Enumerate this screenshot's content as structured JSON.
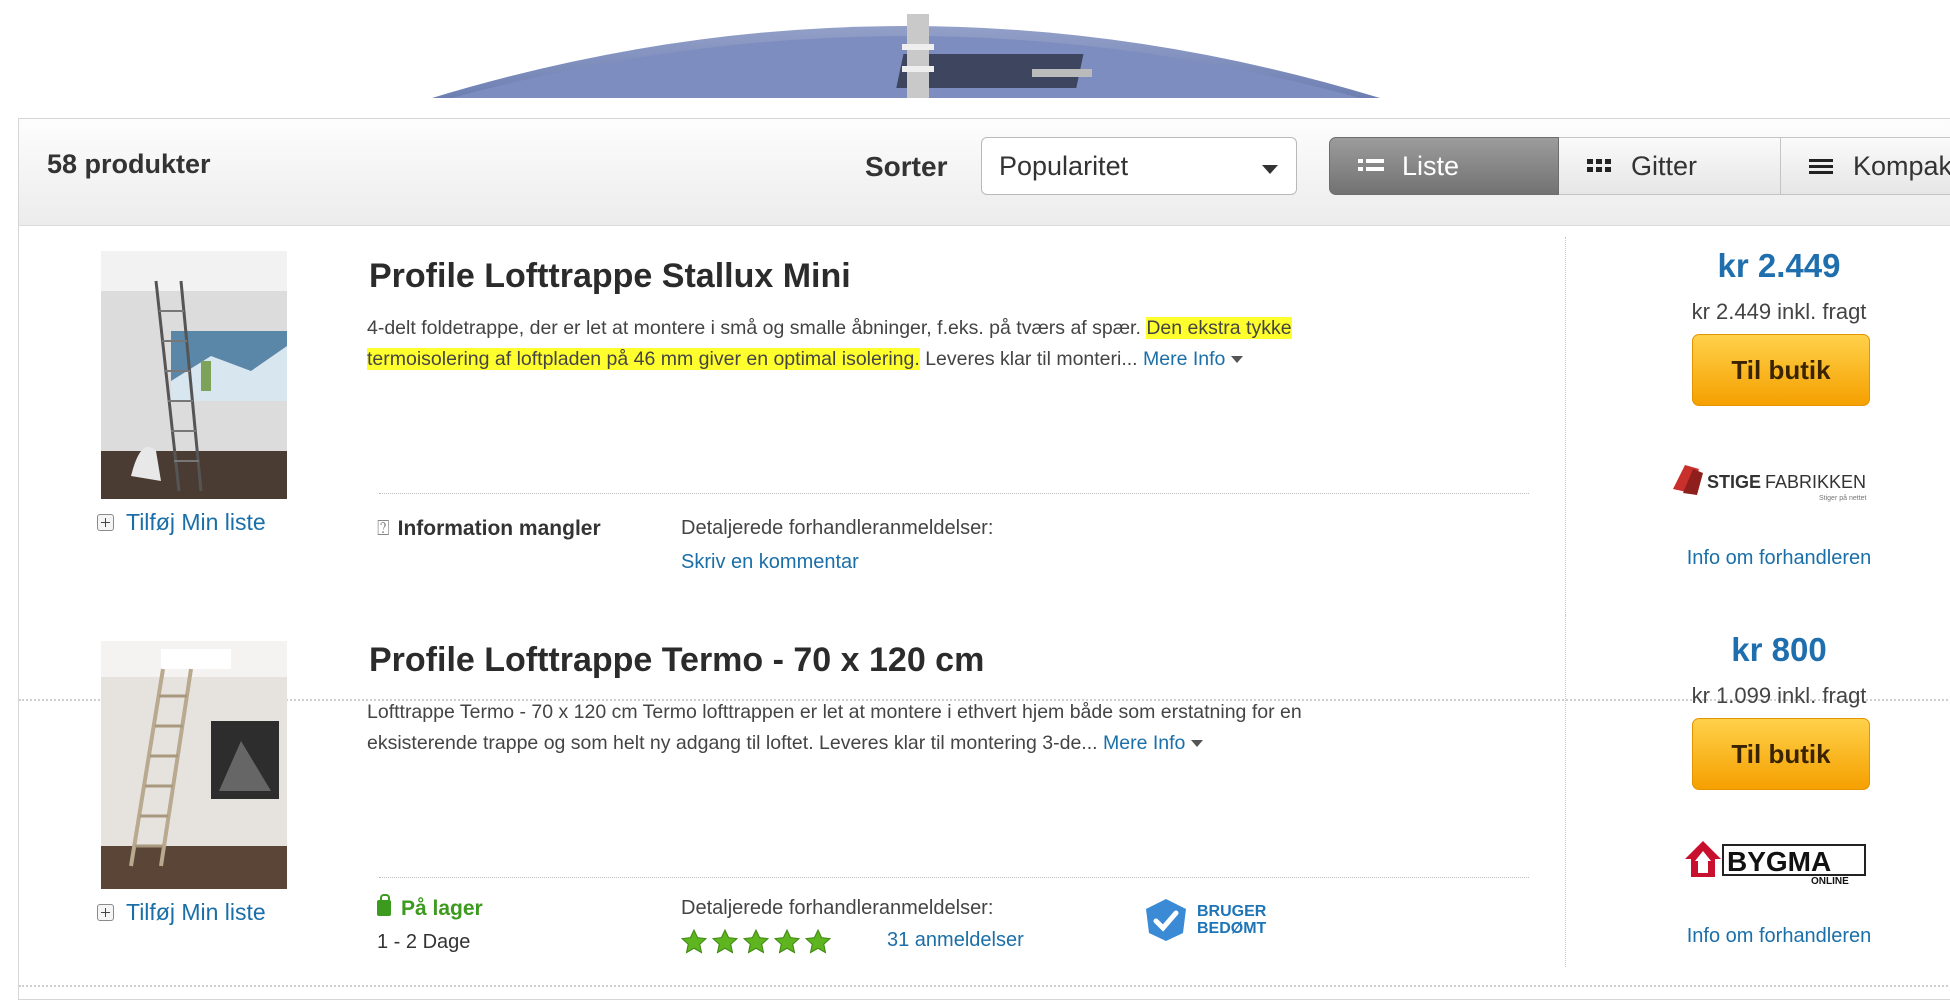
{
  "toolbar": {
    "count": "58 produkter",
    "sort_label": "Sorter",
    "sort_value": "Popularitet",
    "views": {
      "list": "Liste",
      "grid": "Gitter",
      "compact": "Kompakt"
    }
  },
  "products": [
    {
      "title": "Profile Lofttrappe Stallux Mini",
      "desc_a": "4-delt foldetrappe, der er let at montere i små og smalle åbninger, f.eks. på tværs af spær. ",
      "desc_hl": "Den ekstra tykke termoisolering af loftpladen på 46 mm giver en optimal isolering.",
      "desc_b": " Leveres klar til monteri... ",
      "more": "Mere Info",
      "add_list": "Tilføj Min liste",
      "info_missing": "Information mangler",
      "dealer_reviews_label": "Detaljerede forhandleranmeldelser:",
      "dealer_reviews_link": "Skriv en kommentar",
      "price": "kr 2.449",
      "shipping": "kr 2.449 inkl. fragt",
      "shop_button": "Til butik",
      "shop_logo_text": "STIGEFABRIKKEN",
      "shop_logo_tagline": "Stiger på nettet",
      "dealer_info": "Info om forhandleren"
    },
    {
      "title": "Profile Lofttrappe Termo - 70 x 120 cm",
      "desc": "Lofttrappe Termo - 70 x 120 cm Termo lofttrappen er let at montere i ethvert hjem både som erstatning for en eksisterende trappe og som helt ny adgang til loftet. Leveres klar til montering  3-de... ",
      "more": "Mere Info",
      "add_list": "Tilføj Min liste",
      "stock": "På lager",
      "delivery": "1 - 2 Dage",
      "dealer_reviews_label": "Detaljerede forhandleranmeldelser:",
      "rating": 5,
      "reviews": "31 anmeldelser",
      "badge_line1": "BRUGER",
      "badge_line2": "BEDØMT",
      "price": "kr 800",
      "shipping": "kr 1.099 inkl. fragt",
      "shop_button": "Til butik",
      "shop_logo_text": "BYGMA",
      "shop_logo_tagline": "ONLINE",
      "dealer_info": "Info om forhandleren"
    }
  ],
  "colors": {
    "link": "#1a6fa8",
    "price": "#1f6fae",
    "highlight": "#ffff2e",
    "button": "#f5a000",
    "stock": "#3c9a1f"
  }
}
